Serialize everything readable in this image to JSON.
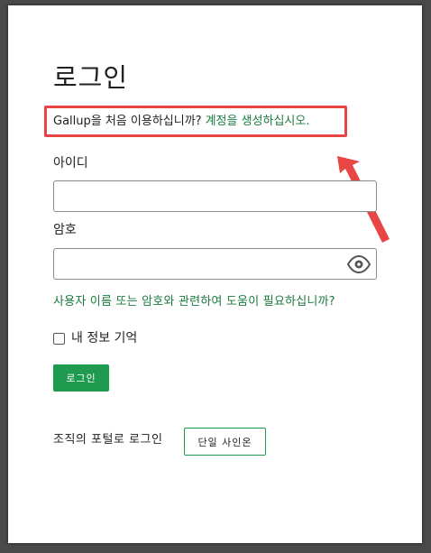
{
  "login": {
    "title": "로그인",
    "intro_text": "Gallup을 처음 이용하십니까?",
    "create_account_link": "계정을 생성하십시오.",
    "id_label": "아이디",
    "id_value": "",
    "password_label": "암호",
    "password_value": "",
    "help_link": "사용자 이름 또는 암호와 관련하여 도움이 필요하십니까?",
    "remember_label": "내 정보 기억",
    "remember_checked": false,
    "login_button": "로그인",
    "org_portal_label": "조직의 포털로 로그인",
    "sso_button": "단일 사인온"
  },
  "colors": {
    "accent_green": "#1f9a4f",
    "link_green": "#1a7a3e",
    "annotation_red": "#e84545",
    "backdrop": "#4a4a4a"
  },
  "icons": {
    "show_password": "eye-icon",
    "annotation": "red-arrow-icon"
  }
}
